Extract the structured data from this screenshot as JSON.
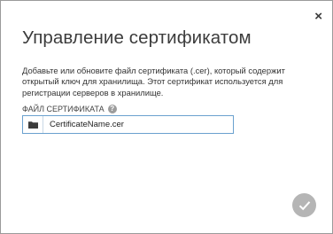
{
  "dialog": {
    "title": "Управление сертификатом",
    "description": "Добавьте или обновите файл сертификата (.cer), который содержит открытый ключ для хранилища. Этот сертификат используется для регистрации серверов в хранилище.",
    "close_label": "×"
  },
  "certificate_field": {
    "label": "ФАЙЛ СЕРТИФИКАТА",
    "help_label": "?",
    "value": "CertificateName.cer"
  },
  "colors": {
    "field_border": "#6aa1cf",
    "ok_button": "#b5b5b5"
  },
  "icons": {
    "close": "close-icon",
    "help": "help-icon",
    "folder": "folder-icon",
    "confirm": "checkmark-icon"
  }
}
